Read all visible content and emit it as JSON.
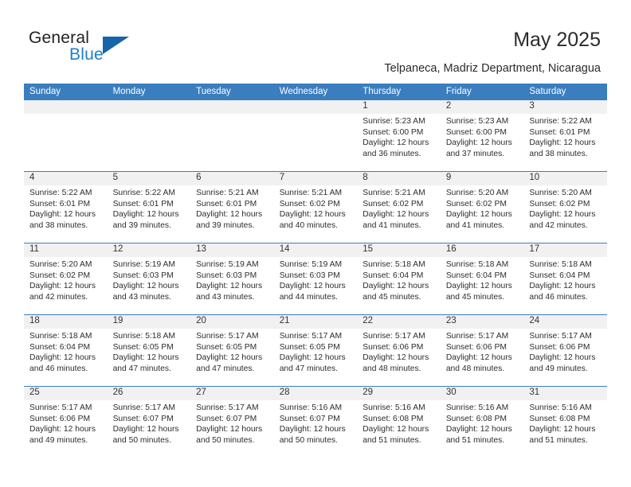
{
  "brand": {
    "name_part1": "General",
    "name_part2": "Blue",
    "accent_color": "#1f7fc4",
    "triangle_color": "#1565a8"
  },
  "header": {
    "title": "May 2025",
    "subtitle": "Telpaneca, Madriz Department, Nicaragua"
  },
  "calendar": {
    "header_bg": "#3a7ebf",
    "daynum_bg": "#f1f1f1",
    "weekdays": [
      "Sunday",
      "Monday",
      "Tuesday",
      "Wednesday",
      "Thursday",
      "Friday",
      "Saturday"
    ],
    "weeks": [
      [
        {
          "day": "",
          "empty": true
        },
        {
          "day": "",
          "empty": true
        },
        {
          "day": "",
          "empty": true
        },
        {
          "day": "",
          "empty": true
        },
        {
          "day": "1",
          "sunrise": "Sunrise: 5:23 AM",
          "sunset": "Sunset: 6:00 PM",
          "daylight1": "Daylight: 12 hours",
          "daylight2": "and 36 minutes."
        },
        {
          "day": "2",
          "sunrise": "Sunrise: 5:23 AM",
          "sunset": "Sunset: 6:00 PM",
          "daylight1": "Daylight: 12 hours",
          "daylight2": "and 37 minutes."
        },
        {
          "day": "3",
          "sunrise": "Sunrise: 5:22 AM",
          "sunset": "Sunset: 6:01 PM",
          "daylight1": "Daylight: 12 hours",
          "daylight2": "and 38 minutes."
        }
      ],
      [
        {
          "day": "4",
          "sunrise": "Sunrise: 5:22 AM",
          "sunset": "Sunset: 6:01 PM",
          "daylight1": "Daylight: 12 hours",
          "daylight2": "and 38 minutes."
        },
        {
          "day": "5",
          "sunrise": "Sunrise: 5:22 AM",
          "sunset": "Sunset: 6:01 PM",
          "daylight1": "Daylight: 12 hours",
          "daylight2": "and 39 minutes."
        },
        {
          "day": "6",
          "sunrise": "Sunrise: 5:21 AM",
          "sunset": "Sunset: 6:01 PM",
          "daylight1": "Daylight: 12 hours",
          "daylight2": "and 39 minutes."
        },
        {
          "day": "7",
          "sunrise": "Sunrise: 5:21 AM",
          "sunset": "Sunset: 6:02 PM",
          "daylight1": "Daylight: 12 hours",
          "daylight2": "and 40 minutes."
        },
        {
          "day": "8",
          "sunrise": "Sunrise: 5:21 AM",
          "sunset": "Sunset: 6:02 PM",
          "daylight1": "Daylight: 12 hours",
          "daylight2": "and 41 minutes."
        },
        {
          "day": "9",
          "sunrise": "Sunrise: 5:20 AM",
          "sunset": "Sunset: 6:02 PM",
          "daylight1": "Daylight: 12 hours",
          "daylight2": "and 41 minutes."
        },
        {
          "day": "10",
          "sunrise": "Sunrise: 5:20 AM",
          "sunset": "Sunset: 6:02 PM",
          "daylight1": "Daylight: 12 hours",
          "daylight2": "and 42 minutes."
        }
      ],
      [
        {
          "day": "11",
          "sunrise": "Sunrise: 5:20 AM",
          "sunset": "Sunset: 6:02 PM",
          "daylight1": "Daylight: 12 hours",
          "daylight2": "and 42 minutes."
        },
        {
          "day": "12",
          "sunrise": "Sunrise: 5:19 AM",
          "sunset": "Sunset: 6:03 PM",
          "daylight1": "Daylight: 12 hours",
          "daylight2": "and 43 minutes."
        },
        {
          "day": "13",
          "sunrise": "Sunrise: 5:19 AM",
          "sunset": "Sunset: 6:03 PM",
          "daylight1": "Daylight: 12 hours",
          "daylight2": "and 43 minutes."
        },
        {
          "day": "14",
          "sunrise": "Sunrise: 5:19 AM",
          "sunset": "Sunset: 6:03 PM",
          "daylight1": "Daylight: 12 hours",
          "daylight2": "and 44 minutes."
        },
        {
          "day": "15",
          "sunrise": "Sunrise: 5:18 AM",
          "sunset": "Sunset: 6:04 PM",
          "daylight1": "Daylight: 12 hours",
          "daylight2": "and 45 minutes."
        },
        {
          "day": "16",
          "sunrise": "Sunrise: 5:18 AM",
          "sunset": "Sunset: 6:04 PM",
          "daylight1": "Daylight: 12 hours",
          "daylight2": "and 45 minutes."
        },
        {
          "day": "17",
          "sunrise": "Sunrise: 5:18 AM",
          "sunset": "Sunset: 6:04 PM",
          "daylight1": "Daylight: 12 hours",
          "daylight2": "and 46 minutes."
        }
      ],
      [
        {
          "day": "18",
          "sunrise": "Sunrise: 5:18 AM",
          "sunset": "Sunset: 6:04 PM",
          "daylight1": "Daylight: 12 hours",
          "daylight2": "and 46 minutes."
        },
        {
          "day": "19",
          "sunrise": "Sunrise: 5:18 AM",
          "sunset": "Sunset: 6:05 PM",
          "daylight1": "Daylight: 12 hours",
          "daylight2": "and 47 minutes."
        },
        {
          "day": "20",
          "sunrise": "Sunrise: 5:17 AM",
          "sunset": "Sunset: 6:05 PM",
          "daylight1": "Daylight: 12 hours",
          "daylight2": "and 47 minutes."
        },
        {
          "day": "21",
          "sunrise": "Sunrise: 5:17 AM",
          "sunset": "Sunset: 6:05 PM",
          "daylight1": "Daylight: 12 hours",
          "daylight2": "and 47 minutes."
        },
        {
          "day": "22",
          "sunrise": "Sunrise: 5:17 AM",
          "sunset": "Sunset: 6:06 PM",
          "daylight1": "Daylight: 12 hours",
          "daylight2": "and 48 minutes."
        },
        {
          "day": "23",
          "sunrise": "Sunrise: 5:17 AM",
          "sunset": "Sunset: 6:06 PM",
          "daylight1": "Daylight: 12 hours",
          "daylight2": "and 48 minutes."
        },
        {
          "day": "24",
          "sunrise": "Sunrise: 5:17 AM",
          "sunset": "Sunset: 6:06 PM",
          "daylight1": "Daylight: 12 hours",
          "daylight2": "and 49 minutes."
        }
      ],
      [
        {
          "day": "25",
          "sunrise": "Sunrise: 5:17 AM",
          "sunset": "Sunset: 6:06 PM",
          "daylight1": "Daylight: 12 hours",
          "daylight2": "and 49 minutes."
        },
        {
          "day": "26",
          "sunrise": "Sunrise: 5:17 AM",
          "sunset": "Sunset: 6:07 PM",
          "daylight1": "Daylight: 12 hours",
          "daylight2": "and 50 minutes."
        },
        {
          "day": "27",
          "sunrise": "Sunrise: 5:17 AM",
          "sunset": "Sunset: 6:07 PM",
          "daylight1": "Daylight: 12 hours",
          "daylight2": "and 50 minutes."
        },
        {
          "day": "28",
          "sunrise": "Sunrise: 5:16 AM",
          "sunset": "Sunset: 6:07 PM",
          "daylight1": "Daylight: 12 hours",
          "daylight2": "and 50 minutes."
        },
        {
          "day": "29",
          "sunrise": "Sunrise: 5:16 AM",
          "sunset": "Sunset: 6:08 PM",
          "daylight1": "Daylight: 12 hours",
          "daylight2": "and 51 minutes."
        },
        {
          "day": "30",
          "sunrise": "Sunrise: 5:16 AM",
          "sunset": "Sunset: 6:08 PM",
          "daylight1": "Daylight: 12 hours",
          "daylight2": "and 51 minutes."
        },
        {
          "day": "31",
          "sunrise": "Sunrise: 5:16 AM",
          "sunset": "Sunset: 6:08 PM",
          "daylight1": "Daylight: 12 hours",
          "daylight2": "and 51 minutes."
        }
      ]
    ]
  }
}
